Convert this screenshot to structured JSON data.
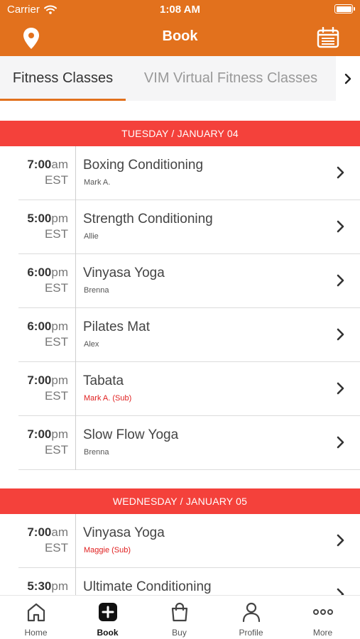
{
  "status_bar": {
    "carrier": "Carrier",
    "time": "1:08 AM"
  },
  "nav": {
    "title": "Book",
    "left_icon": "location-pin-icon",
    "right_icon": "calendar-icon"
  },
  "tabs": [
    {
      "label": "Fitness Classes",
      "selected": true
    },
    {
      "label": "VIM Virtual Fitness Classes",
      "selected": false
    }
  ],
  "colors": {
    "header": "#E2711D",
    "day_header": "#F4413B",
    "substitute_text": "#e02020"
  },
  "days": [
    {
      "header": "TUESDAY / JANUARY 04",
      "classes": [
        {
          "time": "7:00",
          "ampm": "am",
          "tz": "EST",
          "title": "Boxing Conditioning",
          "instructor": "Mark A.",
          "sub": false
        },
        {
          "time": "5:00",
          "ampm": "pm",
          "tz": "EST",
          "title": "Strength Conditioning",
          "instructor": "Allie",
          "sub": false
        },
        {
          "time": "6:00",
          "ampm": "pm",
          "tz": "EST",
          "title": "Vinyasa Yoga",
          "instructor": "Brenna",
          "sub": false
        },
        {
          "time": "6:00",
          "ampm": "pm",
          "tz": "EST",
          "title": "Pilates Mat",
          "instructor": "Alex",
          "sub": false
        },
        {
          "time": "7:00",
          "ampm": "pm",
          "tz": "EST",
          "title": "Tabata",
          "instructor": "Mark A. (Sub)",
          "sub": true
        },
        {
          "time": "7:00",
          "ampm": "pm",
          "tz": "EST",
          "title": "Slow Flow Yoga",
          "instructor": "Brenna",
          "sub": false
        }
      ]
    },
    {
      "header": "WEDNESDAY / JANUARY 05",
      "classes": [
        {
          "time": "7:00",
          "ampm": "am",
          "tz": "EST",
          "title": "Vinyasa Yoga",
          "instructor": "Maggie (Sub)",
          "sub": true
        },
        {
          "time": "5:30",
          "ampm": "pm",
          "tz": "",
          "title": "Ultimate Conditioning",
          "instructor": "",
          "sub": false
        }
      ]
    }
  ],
  "tabbar": [
    {
      "label": "Home",
      "icon": "home-icon",
      "active": false
    },
    {
      "label": "Book",
      "icon": "plus-square-icon",
      "active": true
    },
    {
      "label": "Buy",
      "icon": "shopping-bag-icon",
      "active": false
    },
    {
      "label": "Profile",
      "icon": "person-icon",
      "active": false
    },
    {
      "label": "More",
      "icon": "more-dots-icon",
      "active": false
    }
  ]
}
